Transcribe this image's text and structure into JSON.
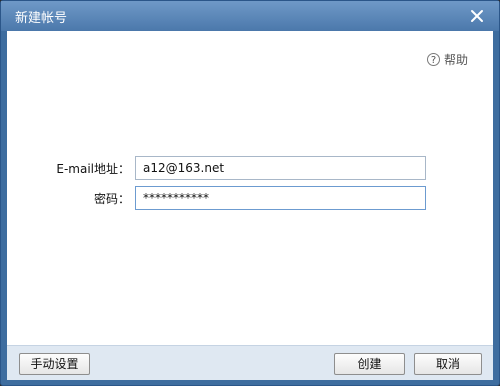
{
  "window": {
    "title": "新建帐号",
    "close_icon": "close-icon"
  },
  "help": {
    "icon": "question-circle-icon",
    "label": "帮助"
  },
  "form": {
    "email_label": "E-mail地址：",
    "email_value": "a12@163.net",
    "password_label": "密码：",
    "password_value": "***********"
  },
  "footer": {
    "manual_settings_label": "手动设置",
    "create_label": "创建",
    "cancel_label": "取消"
  }
}
